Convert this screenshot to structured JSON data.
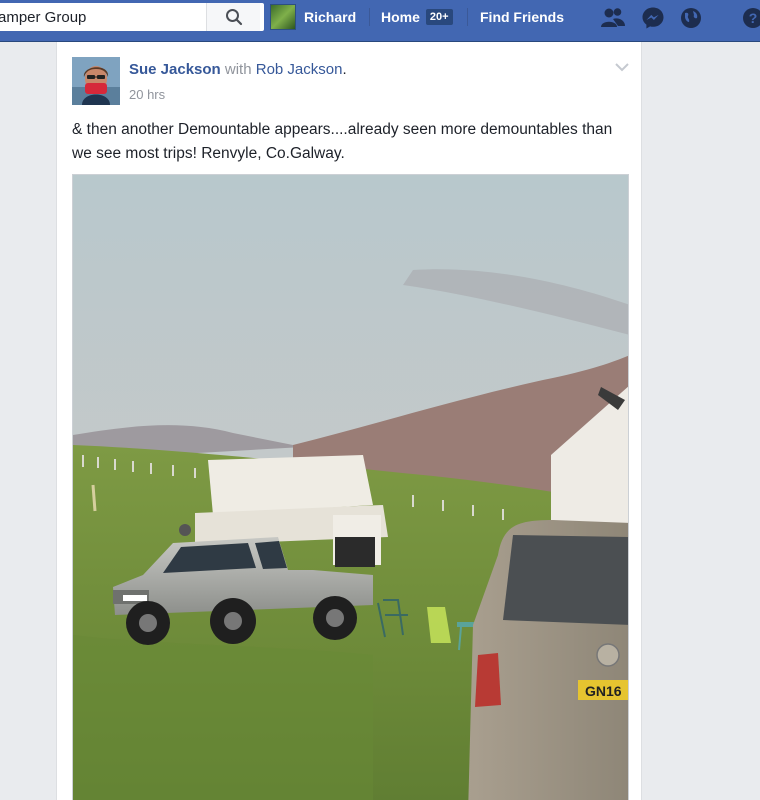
{
  "topbar": {
    "search": {
      "value": "amper Group"
    },
    "profile_name": "Richard",
    "home_label": "Home",
    "home_badge": "20+",
    "find_friends": "Find Friends",
    "icons": [
      "search-icon",
      "friend-requests-icon",
      "messenger-icon",
      "globe-notifications-icon",
      "help-icon"
    ]
  },
  "post": {
    "author": "Sue Jackson",
    "with_word": "with",
    "tagged": "Rob Jackson",
    "period": ".",
    "time": "20 hrs",
    "text": "& then another Demountable appears....already seen more demountables than we see most trips! Renvyle, Co.Galway.",
    "photo": {
      "description": "Photo of campervans parked on green grass",
      "plate_text": "GN16"
    }
  },
  "colors": {
    "topbar": "#4267b2",
    "link": "#365899",
    "background": "#e9ebee"
  }
}
